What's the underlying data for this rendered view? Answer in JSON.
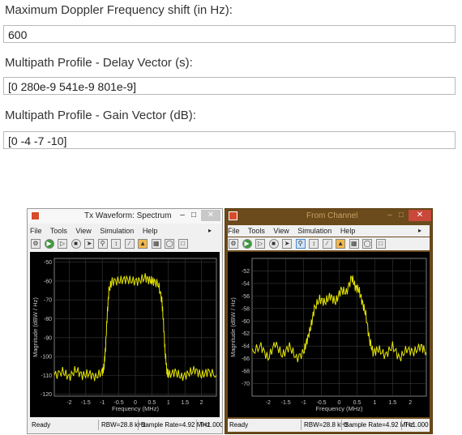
{
  "form": {
    "doppler_label": "Maximum Doppler Frequency shift (in Hz):",
    "doppler_value": "600",
    "delay_label": "Multipath Profile - Delay Vector (s):",
    "delay_value": "[0 280e-9 541e-9 801e-9]",
    "gain_label": "Multipath Profile - Gain Vector (dB):",
    "gain_value": "[0 -4 -7 -10]"
  },
  "windows": [
    {
      "title": "Tx Waveform: Spectrum",
      "menu": [
        "File",
        "Tools",
        "View",
        "Simulation",
        "Help"
      ],
      "status": {
        "left": "Ready",
        "rbw": "RBW=28.8 kHz",
        "rate": "Sample Rate=4.92 MHz",
        "time": "T=1.000"
      }
    },
    {
      "title": "From Channel",
      "menu": [
        "File",
        "Tools",
        "View",
        "Simulation",
        "Help"
      ],
      "status": {
        "left": "Ready",
        "rbw": "RBW=28.8 kHz",
        "rate": "Sample Rate=4.92 MHz",
        "time": "T=1.000"
      }
    }
  ],
  "chart_data": [
    {
      "type": "line",
      "xlabel": "Frequency (MHz)",
      "ylabel": "Magnitude (dBW / Hz)",
      "xlim": [
        -2.45,
        2.45
      ],
      "ylim": [
        -121,
        -48
      ],
      "xticks": [
        "-2",
        "-1.5",
        "-1",
        "-0.5",
        "0",
        "0.5",
        "1",
        "1.5",
        "2"
      ],
      "yticks": [
        "-50",
        "-60",
        "-70",
        "-80",
        "-90",
        "-100",
        "-110",
        "-120"
      ],
      "grid": true,
      "color": "#e6e600",
      "series": [
        {
          "x": [
            -2.45,
            -2.2,
            -2.0,
            -1.8,
            -1.6,
            -1.4,
            -1.2,
            -1.0,
            -0.95,
            -0.9,
            -0.85,
            -0.8,
            -0.7,
            -0.5,
            -0.3,
            -0.1,
            0.1,
            0.3,
            0.45,
            0.55,
            0.7,
            0.8,
            0.85,
            0.9,
            0.95,
            1.0,
            1.2,
            1.4,
            1.6,
            1.8,
            2.0,
            2.2,
            2.45
          ],
          "y": [
            -110,
            -108,
            -111,
            -107,
            -110,
            -109,
            -111,
            -108,
            -106,
            -95,
            -78,
            -65,
            -60,
            -60,
            -59,
            -60,
            -60,
            -58,
            -60,
            -60,
            -62,
            -70,
            -82,
            -98,
            -107,
            -110,
            -108,
            -111,
            -109,
            -107,
            -110,
            -108,
            -110
          ]
        }
      ]
    },
    {
      "type": "line",
      "xlabel": "Frequency (MHz)",
      "ylabel": "Magnitude (dBW / Hz)",
      "xlim": [
        -2.45,
        2.45
      ],
      "ylim": [
        -72,
        -50
      ],
      "xticks": [
        "-2",
        "-1.5",
        "-1",
        "-0.5",
        "0",
        "0.5",
        "1",
        "1.5",
        "2"
      ],
      "yticks": [
        "-52",
        "-54",
        "-56",
        "-58",
        "-60",
        "-62",
        "-64",
        "-66",
        "-68",
        "-70"
      ],
      "grid": true,
      "color": "#e6e600",
      "series": [
        {
          "x": [
            -2.45,
            -2.2,
            -2.0,
            -1.8,
            -1.6,
            -1.4,
            -1.2,
            -1.0,
            -0.9,
            -0.8,
            -0.7,
            -0.55,
            -0.4,
            -0.25,
            -0.1,
            0.05,
            0.2,
            0.35,
            0.45,
            0.55,
            0.65,
            0.75,
            0.85,
            0.95,
            1.1,
            1.3,
            1.5,
            1.7,
            1.9,
            2.1,
            2.3,
            2.45
          ],
          "y": [
            -65,
            -64,
            -66,
            -63.5,
            -65.5,
            -64,
            -66,
            -65,
            -63,
            -61,
            -58,
            -56.5,
            -57,
            -56,
            -57,
            -55,
            -55.5,
            -53,
            -54.5,
            -55,
            -57,
            -59,
            -63,
            -65,
            -64.5,
            -65.5,
            -64,
            -66,
            -64.5,
            -65,
            -64,
            -65
          ]
        }
      ]
    }
  ]
}
